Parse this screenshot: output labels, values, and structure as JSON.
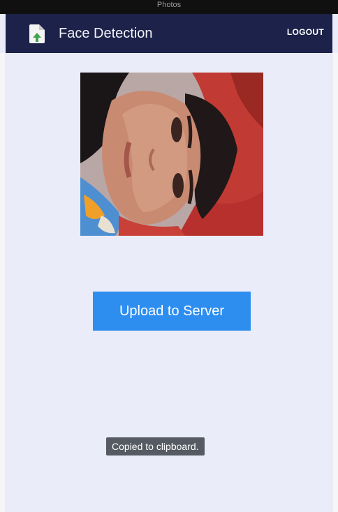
{
  "status_bar": {
    "title": "Photos"
  },
  "app_bar": {
    "title": "Face Detection",
    "logout_label": "LOGOUT",
    "icon": "document-upload-icon",
    "background_color": "#1c2249"
  },
  "main": {
    "photo": {
      "subject": "selected-face-photo"
    },
    "upload_button_label": "Upload to Server",
    "accent_color": "#2d8ef0"
  },
  "toast": {
    "message": "Copied to clipboard."
  }
}
